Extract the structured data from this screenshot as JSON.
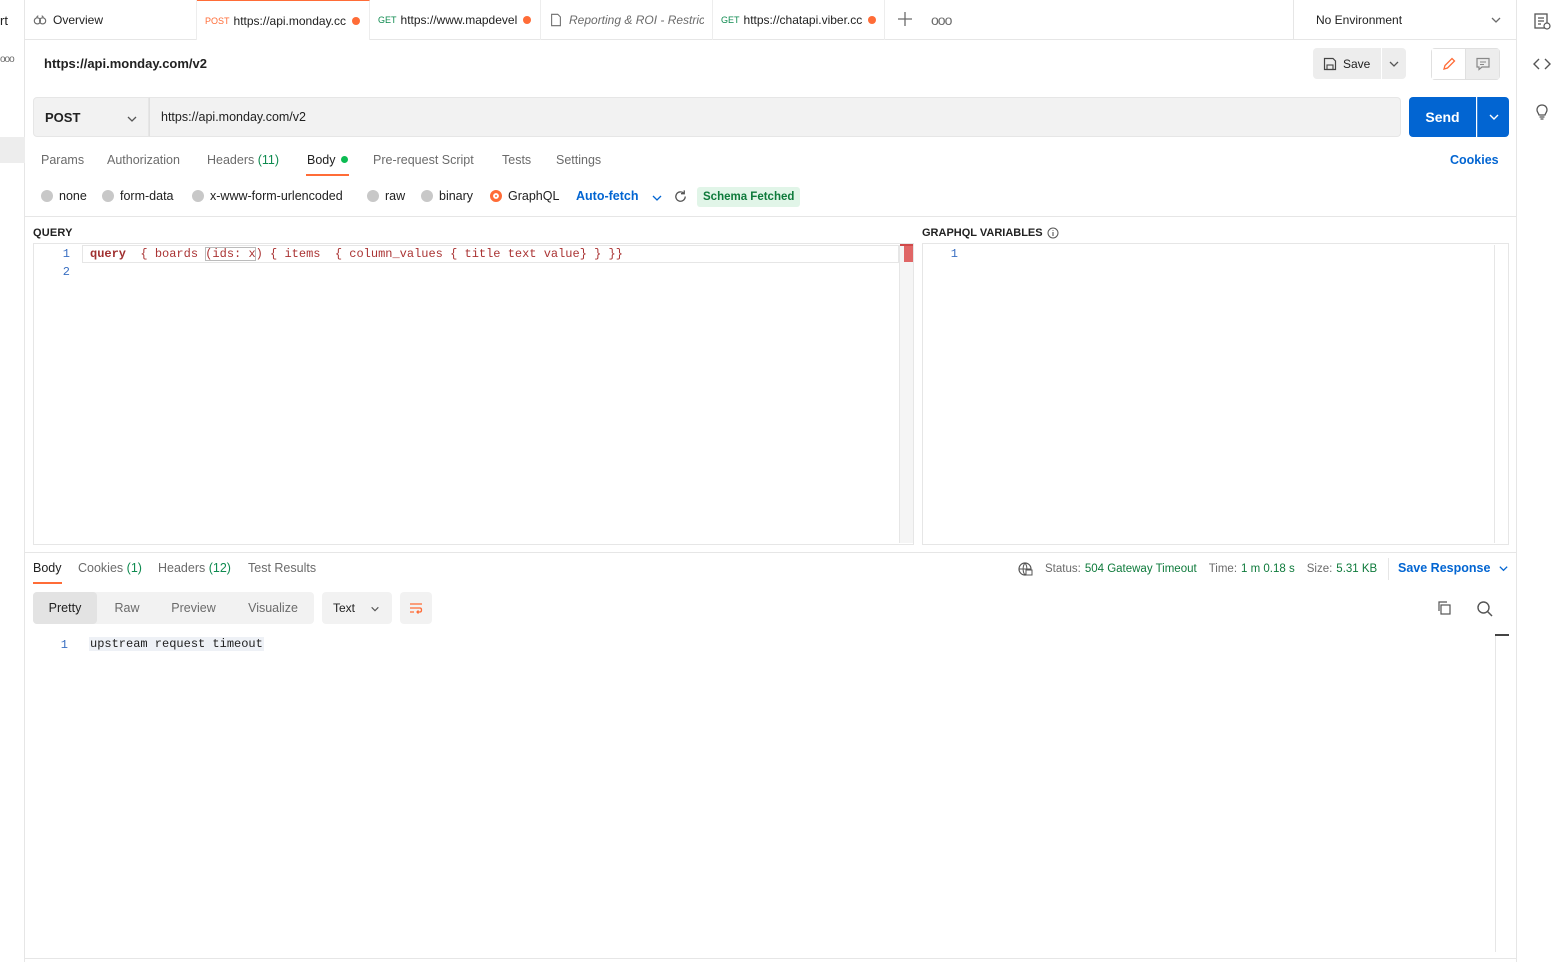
{
  "left_strip": {
    "fragment": "rt",
    "more": "ooo"
  },
  "tabs": [
    {
      "method": "",
      "label": "Overview",
      "dirty": false
    },
    {
      "method": "POST",
      "label": "https://api.monday.cc",
      "dirty": true
    },
    {
      "method": "GET",
      "label": "https://www.mapdevel",
      "dirty": true
    },
    {
      "method": "",
      "label": "Reporting & ROI - Restrict",
      "dirty": false
    },
    {
      "method": "GET",
      "label": "https://chatapi.viber.cc",
      "dirty": true
    }
  ],
  "tab_more": "ooo",
  "environment": {
    "selected": "No Environment"
  },
  "request": {
    "title": "https://api.monday.com/v2",
    "method": "POST",
    "url": "https://api.monday.com/v2",
    "save_label": "Save",
    "send_label": "Send"
  },
  "request_tabs": [
    {
      "label": "Params",
      "count": ""
    },
    {
      "label": "Authorization",
      "count": ""
    },
    {
      "label": "Headers",
      "count": "(11)"
    },
    {
      "label": "Body",
      "count": ""
    },
    {
      "label": "Pre-request Script",
      "count": ""
    },
    {
      "label": "Tests",
      "count": ""
    },
    {
      "label": "Settings",
      "count": ""
    }
  ],
  "cookies_link": "Cookies",
  "body_types": [
    "none",
    "form-data",
    "x-www-form-urlencoded",
    "raw",
    "binary",
    "GraphQL"
  ],
  "body_type_selected": "GraphQL",
  "auto_fetch": "Auto-fetch",
  "schema_status": "Schema Fetched",
  "query": {
    "label": "QUERY",
    "line_numbers": [
      "1",
      "2"
    ],
    "code": {
      "kw": "query",
      "rest_a": "  { boards ",
      "rest_b": "(ids: x",
      "rest_c": ") { items  { column_values { title text value} } }}"
    }
  },
  "variables": {
    "label": "GRAPHQL VARIABLES",
    "line_numbers": [
      "1"
    ]
  },
  "response_tabs": [
    {
      "label": "Body",
      "count": ""
    },
    {
      "label": "Cookies",
      "count": "(1)"
    },
    {
      "label": "Headers",
      "count": "(12)"
    },
    {
      "label": "Test Results",
      "count": ""
    }
  ],
  "response_meta": {
    "status_label": "Status:",
    "status_value": "504 Gateway Timeout",
    "time_label": "Time:",
    "time_value": "1 m 0.18 s",
    "size_label": "Size:",
    "size_value": "5.31 KB",
    "save_response": "Save Response"
  },
  "response_formats": [
    "Pretty",
    "Raw",
    "Preview",
    "Visualize"
  ],
  "response_format_selected": "Pretty",
  "response_type": "Text",
  "response_body": {
    "line_numbers": [
      "1"
    ],
    "text": "upstream request timeout"
  },
  "colors": {
    "accent": "#ff6c37",
    "primary": "#0265d2",
    "success": "#0e7a3b"
  }
}
